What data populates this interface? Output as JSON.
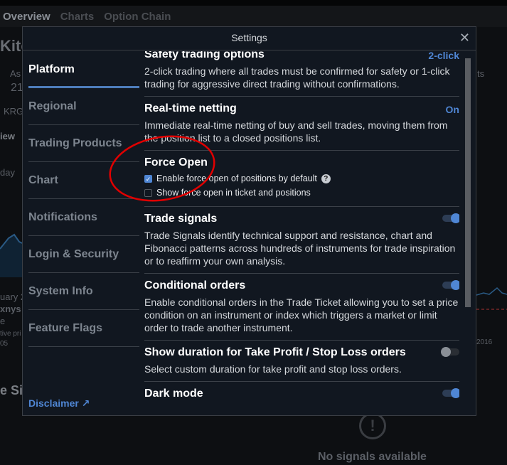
{
  "background": {
    "tabs": [
      "Overview",
      "Charts",
      "Option Chain"
    ],
    "fragments": [
      "Kite",
      "As",
      "21",
      "KRG",
      "iew",
      "day",
      "uary 2",
      "xnys",
      "e",
      "tive pri",
      "05",
      "e Sig",
      "ts",
      "2016"
    ],
    "no_signals": "No signals available"
  },
  "modal": {
    "title": "Settings",
    "close_icon": "close-icon",
    "nav": [
      {
        "label": "Platform",
        "active": true
      },
      {
        "label": "Regional"
      },
      {
        "label": "Trading Products"
      },
      {
        "label": "Chart"
      },
      {
        "label": "Notifications"
      },
      {
        "label": "Login & Security"
      },
      {
        "label": "System Info"
      },
      {
        "label": "Feature Flags"
      }
    ],
    "disclaimer": "Disclaimer",
    "sections": [
      {
        "title": "Safety trading options",
        "value": "2-click",
        "desc": "2-click trading where all trades must be confirmed for safety or 1-click trading for aggressive direct trading without confirmations."
      },
      {
        "title": "Real-time netting",
        "value": "On",
        "desc": "Immediate real-time netting of buy and sell trades, moving them from the position list to a closed positions list."
      },
      {
        "title": "Force Open",
        "checkboxes": [
          {
            "label": "Enable force open of positions by default",
            "checked": true,
            "help": "?"
          },
          {
            "label": "Show force open in ticket and positions",
            "checked": false
          }
        ]
      },
      {
        "title": "Trade signals",
        "toggle": true,
        "desc": "Trade Signals identify technical support and resistance, chart and Fibonacci patterns across hundreds of instruments for trade inspiration or to reaffirm your own analysis."
      },
      {
        "title": "Conditional orders",
        "toggle": true,
        "desc": "Enable conditional orders in the Trade Ticket allowing you to set a price condition on an instrument or index which triggers a market or limit order to trade another instrument."
      },
      {
        "title": "Show duration for Take Profit / Stop Loss orders",
        "toggle": false,
        "desc": "Select custom duration for take profit and stop loss orders."
      },
      {
        "title": "Dark mode",
        "toggle": true
      }
    ]
  },
  "colors": {
    "accent": "#4f86d4",
    "annotation": "#e00000",
    "modal_bg": "#111720"
  }
}
